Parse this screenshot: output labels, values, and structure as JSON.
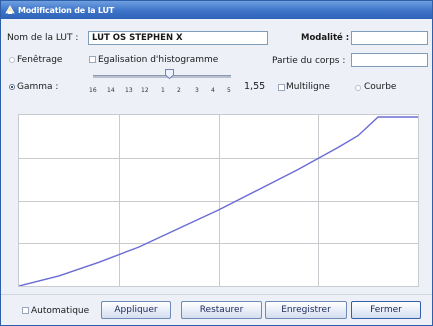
{
  "window": {
    "title": "Modification de la LUT"
  },
  "form": {
    "nom_label": "Nom de la LUT :",
    "nom_value": "LUT OS STEPHEN X",
    "modalite_label": "Modalité :",
    "modalite_value": "",
    "partie_label": "Partie du corps :",
    "partie_value": "",
    "fenetrage_label": "Fenêtrage",
    "egalisation_label": "Egalisation d'histogramme",
    "gamma_label": "Gamma :",
    "gamma_value": "1,55",
    "multiligne_label": "Multiligne",
    "courbe_label": "Courbe",
    "mode_selected": "Gamma",
    "egalisation_checked": false,
    "multiligne_checked": false
  },
  "slider": {
    "ticks": [
      "16",
      "14",
      "13",
      "12",
      "1",
      "2",
      "3",
      "4",
      "5"
    ],
    "level": 0.55
  },
  "chart_data": {
    "type": "line",
    "grid": true,
    "xlim": [
      0,
      1
    ],
    "ylim": [
      0,
      1
    ],
    "gamma": 1.55,
    "series": [
      {
        "x": [
          0,
          0.1,
          0.2,
          0.3,
          0.4,
          0.5,
          0.6,
          0.7,
          0.8,
          0.85,
          0.9,
          1.0
        ],
        "y": [
          0,
          0.06,
          0.14,
          0.23,
          0.34,
          0.45,
          0.57,
          0.69,
          0.82,
          0.89,
          1.0,
          1.0
        ]
      }
    ],
    "line_color": "#6b6bd6"
  },
  "footer": {
    "automatique_label": "Automatique",
    "automatique_checked": false,
    "buttons": [
      "Appliquer",
      "Restaurer",
      "Enregistrer",
      "Fermer"
    ]
  }
}
